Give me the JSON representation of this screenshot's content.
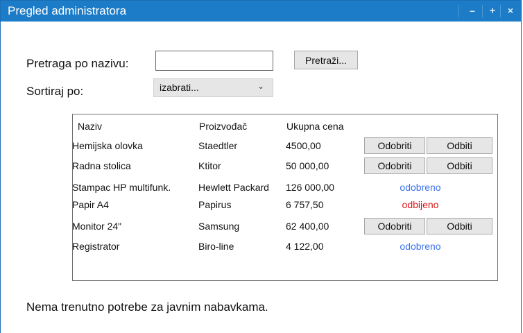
{
  "window": {
    "title": "Pregled administratora",
    "controls": [
      "–",
      "+",
      "×"
    ]
  },
  "search": {
    "label": "Pretraga po nazivu:",
    "value": "",
    "placeholder": "",
    "button_label": "Pretraži..."
  },
  "sort": {
    "label": "Sortiraj po:",
    "selected": "izabrati..."
  },
  "table": {
    "headers": [
      "Naziv",
      "Proizvođač",
      "Ukupna cena"
    ],
    "rows": [
      {
        "name": "Hemijska olovka",
        "maker": "Staedtler",
        "price": "4500,00",
        "status": "",
        "approve": "Odobriti",
        "reject": "Odbiti"
      },
      {
        "name": "Radna stolica",
        "maker": "Ktitor",
        "price": "50 000,00",
        "status": "",
        "approve": "Odobriti",
        "reject": "Odbiti"
      },
      {
        "name": "Stampac HP multifunk.",
        "maker": "Hewlett Packard",
        "price": "126 000,00",
        "status": "odobreno",
        "approve": "",
        "reject": ""
      },
      {
        "name": "Papir A4",
        "maker": "Papirus",
        "price": "6 757,50",
        "status": "odbijeno",
        "approve": "",
        "reject": ""
      },
      {
        "name": "Monitor 24\"",
        "maker": "Samsung",
        "price": "62 400,00",
        "status": "",
        "approve": "Odobriti",
        "reject": "Odbiti"
      },
      {
        "name": "Registrator",
        "maker": "Biro-line",
        "price": "4 122,00",
        "status": "odobreno",
        "approve": "",
        "reject": ""
      }
    ]
  },
  "message": "Nema trenutno potrebe za javnim nabavkama.",
  "colors": {
    "titlebar": "#1d7cc7",
    "approved": "#3a6ff0",
    "rejected": "#e0141a"
  }
}
